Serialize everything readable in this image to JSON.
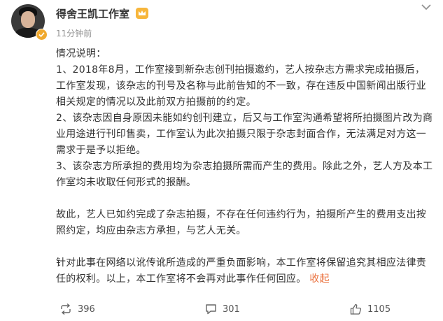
{
  "post": {
    "author": "得舍王凯工作室",
    "time": "11分钟前",
    "paragraphs": [
      "情况说明：",
      "1、2018年8月，工作室接到新杂志创刊拍摄邀约，艺人按杂志方需求完成拍摄后，工作室发现，该杂志的刊号及名称与此前告知的不一致，存在违反中国新闻出版行业相关规定的情况以及此前双方拍摄前的约定。",
      "2、该杂志因自身原因未能如约创刊建立，后又与工作室沟通希望将所拍摄图片改为商业用途进行刊印售卖，工作室认为此次拍摄只限于杂志封面合作，无法满足对方这一需求于是予以拒绝。",
      "3、该杂志方所承担的费用均为杂志拍摄所需而产生的费用。除此之外，艺人方及本工作室均未收取任何形式的报酬。",
      "故此，艺人已如约完成了杂志拍摄，不存在任何违约行为，拍摄所产生的费用支出按照约定，均应由杂志方承担，与艺人无关。",
      "针对此事在网络以讹传讹所造成的严重负面影响，本工作室将保留追究其相应法律责任的权利。以上，本工作室将不会再对此事作任何回应。"
    ],
    "collapse_label": "收起"
  },
  "actions": {
    "repost_count": "396",
    "comment_count": "301",
    "like_count": "1105"
  },
  "colors": {
    "link": "#eb7340",
    "badge": "#f0a92e",
    "muted": "#939393"
  },
  "icons": [
    "avatar",
    "verified-badge-icon",
    "crown-icon",
    "chevron-down-icon",
    "repost-icon",
    "comment-icon",
    "like-icon"
  ]
}
